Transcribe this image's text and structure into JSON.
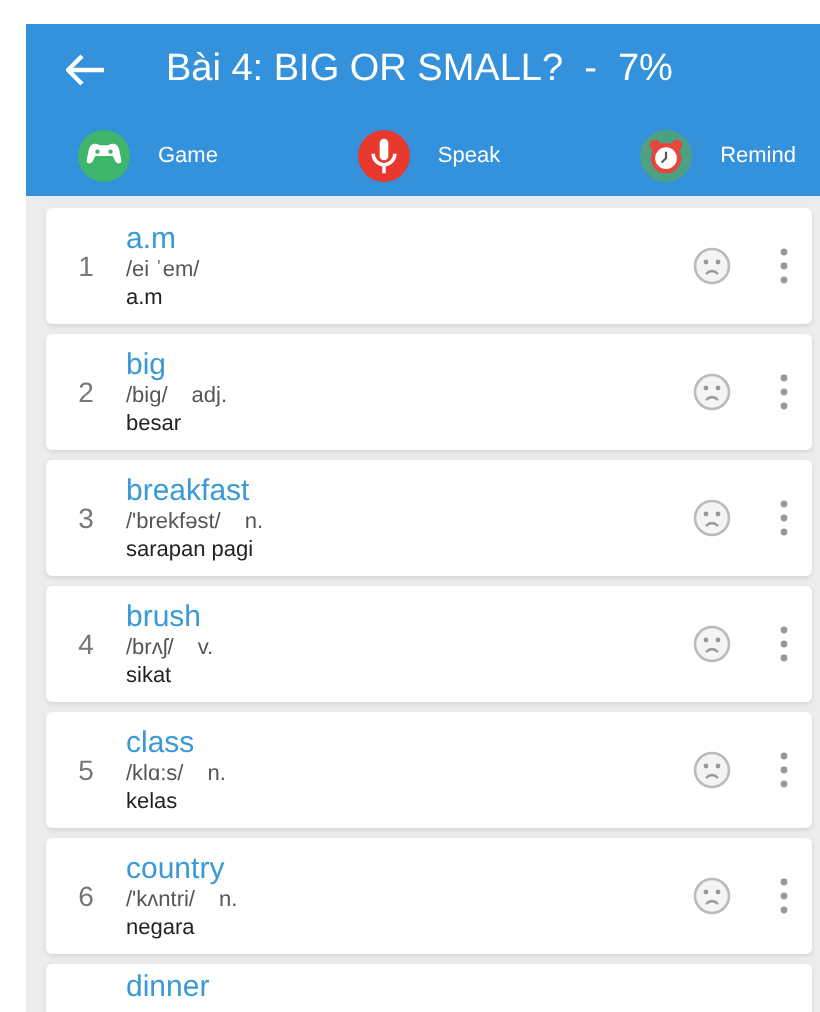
{
  "header": {
    "title": "Bài 4: BIG OR SMALL?  -  7%"
  },
  "actions": [
    {
      "kind": "game",
      "label": "Game"
    },
    {
      "kind": "speak",
      "label": "Speak"
    },
    {
      "kind": "remind",
      "label": "Remind"
    }
  ],
  "words": [
    {
      "number": "1",
      "word": "a.m",
      "phonetic": "/ei ˈem/",
      "meaning": "a.m"
    },
    {
      "number": "2",
      "word": "big",
      "phonetic": "/big/",
      "pos": "adj.",
      "meaning": "besar"
    },
    {
      "number": "3",
      "word": "breakfast",
      "phonetic": "/'brekfəst/",
      "pos": "n.",
      "meaning": "sarapan pagi"
    },
    {
      "number": "4",
      "word": "brush",
      "phonetic": "/brʌʃ/",
      "pos": "v.",
      "meaning": "sikat"
    },
    {
      "number": "5",
      "word": "class",
      "phonetic": "/klɑ:s/",
      "pos": "n.",
      "meaning": "kelas"
    },
    {
      "number": "6",
      "word": "country",
      "phonetic": "/'kʌntri/",
      "pos": "n.",
      "meaning": "negara"
    },
    {
      "word": "dinner"
    }
  ]
}
